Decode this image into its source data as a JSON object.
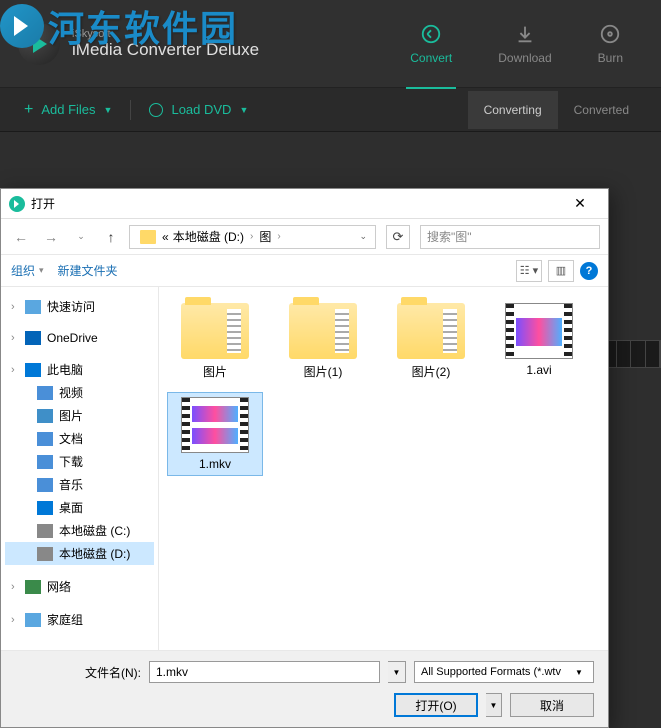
{
  "watermark": "河东软件园",
  "app": {
    "brand_small": "iSkysoft",
    "brand_large": "iMedia Converter Deluxe",
    "nav": {
      "convert": "Convert",
      "download": "Download",
      "burn": "Burn"
    },
    "toolbar": {
      "add_files": "Add Files",
      "load_dvd": "Load DVD"
    },
    "subtabs": {
      "converting": "Converting",
      "converted": "Converted"
    }
  },
  "dialog": {
    "title": "打开",
    "breadcrumb": {
      "prefix": "«",
      "seg1": "本地磁盘 (D:)",
      "seg2": "图"
    },
    "search_placeholder": "搜索\"图\"",
    "org": {
      "organize": "组织",
      "new_folder": "新建文件夹"
    },
    "tree": {
      "quick": "快速访问",
      "onedrive": "OneDrive",
      "thispc": "此电脑",
      "video": "视频",
      "pictures": "图片",
      "docs": "文档",
      "downloads": "下载",
      "music": "音乐",
      "desktop": "桌面",
      "diskc": "本地磁盘 (C:)",
      "diskd": "本地磁盘 (D:)",
      "network": "网络",
      "homegroup": "家庭组"
    },
    "files": [
      {
        "name": "图片",
        "type": "folder"
      },
      {
        "name": "图片(1)",
        "type": "folder"
      },
      {
        "name": "图片(2)",
        "type": "folder"
      },
      {
        "name": "1.avi",
        "type": "video"
      },
      {
        "name": "1.mkv",
        "type": "video",
        "selected": true
      }
    ],
    "footer": {
      "fn_label": "文件名(N):",
      "fn_value": "1.mkv",
      "filter": "All Supported Formats (*.wtv",
      "open": "打开(O)",
      "cancel": "取消"
    }
  }
}
